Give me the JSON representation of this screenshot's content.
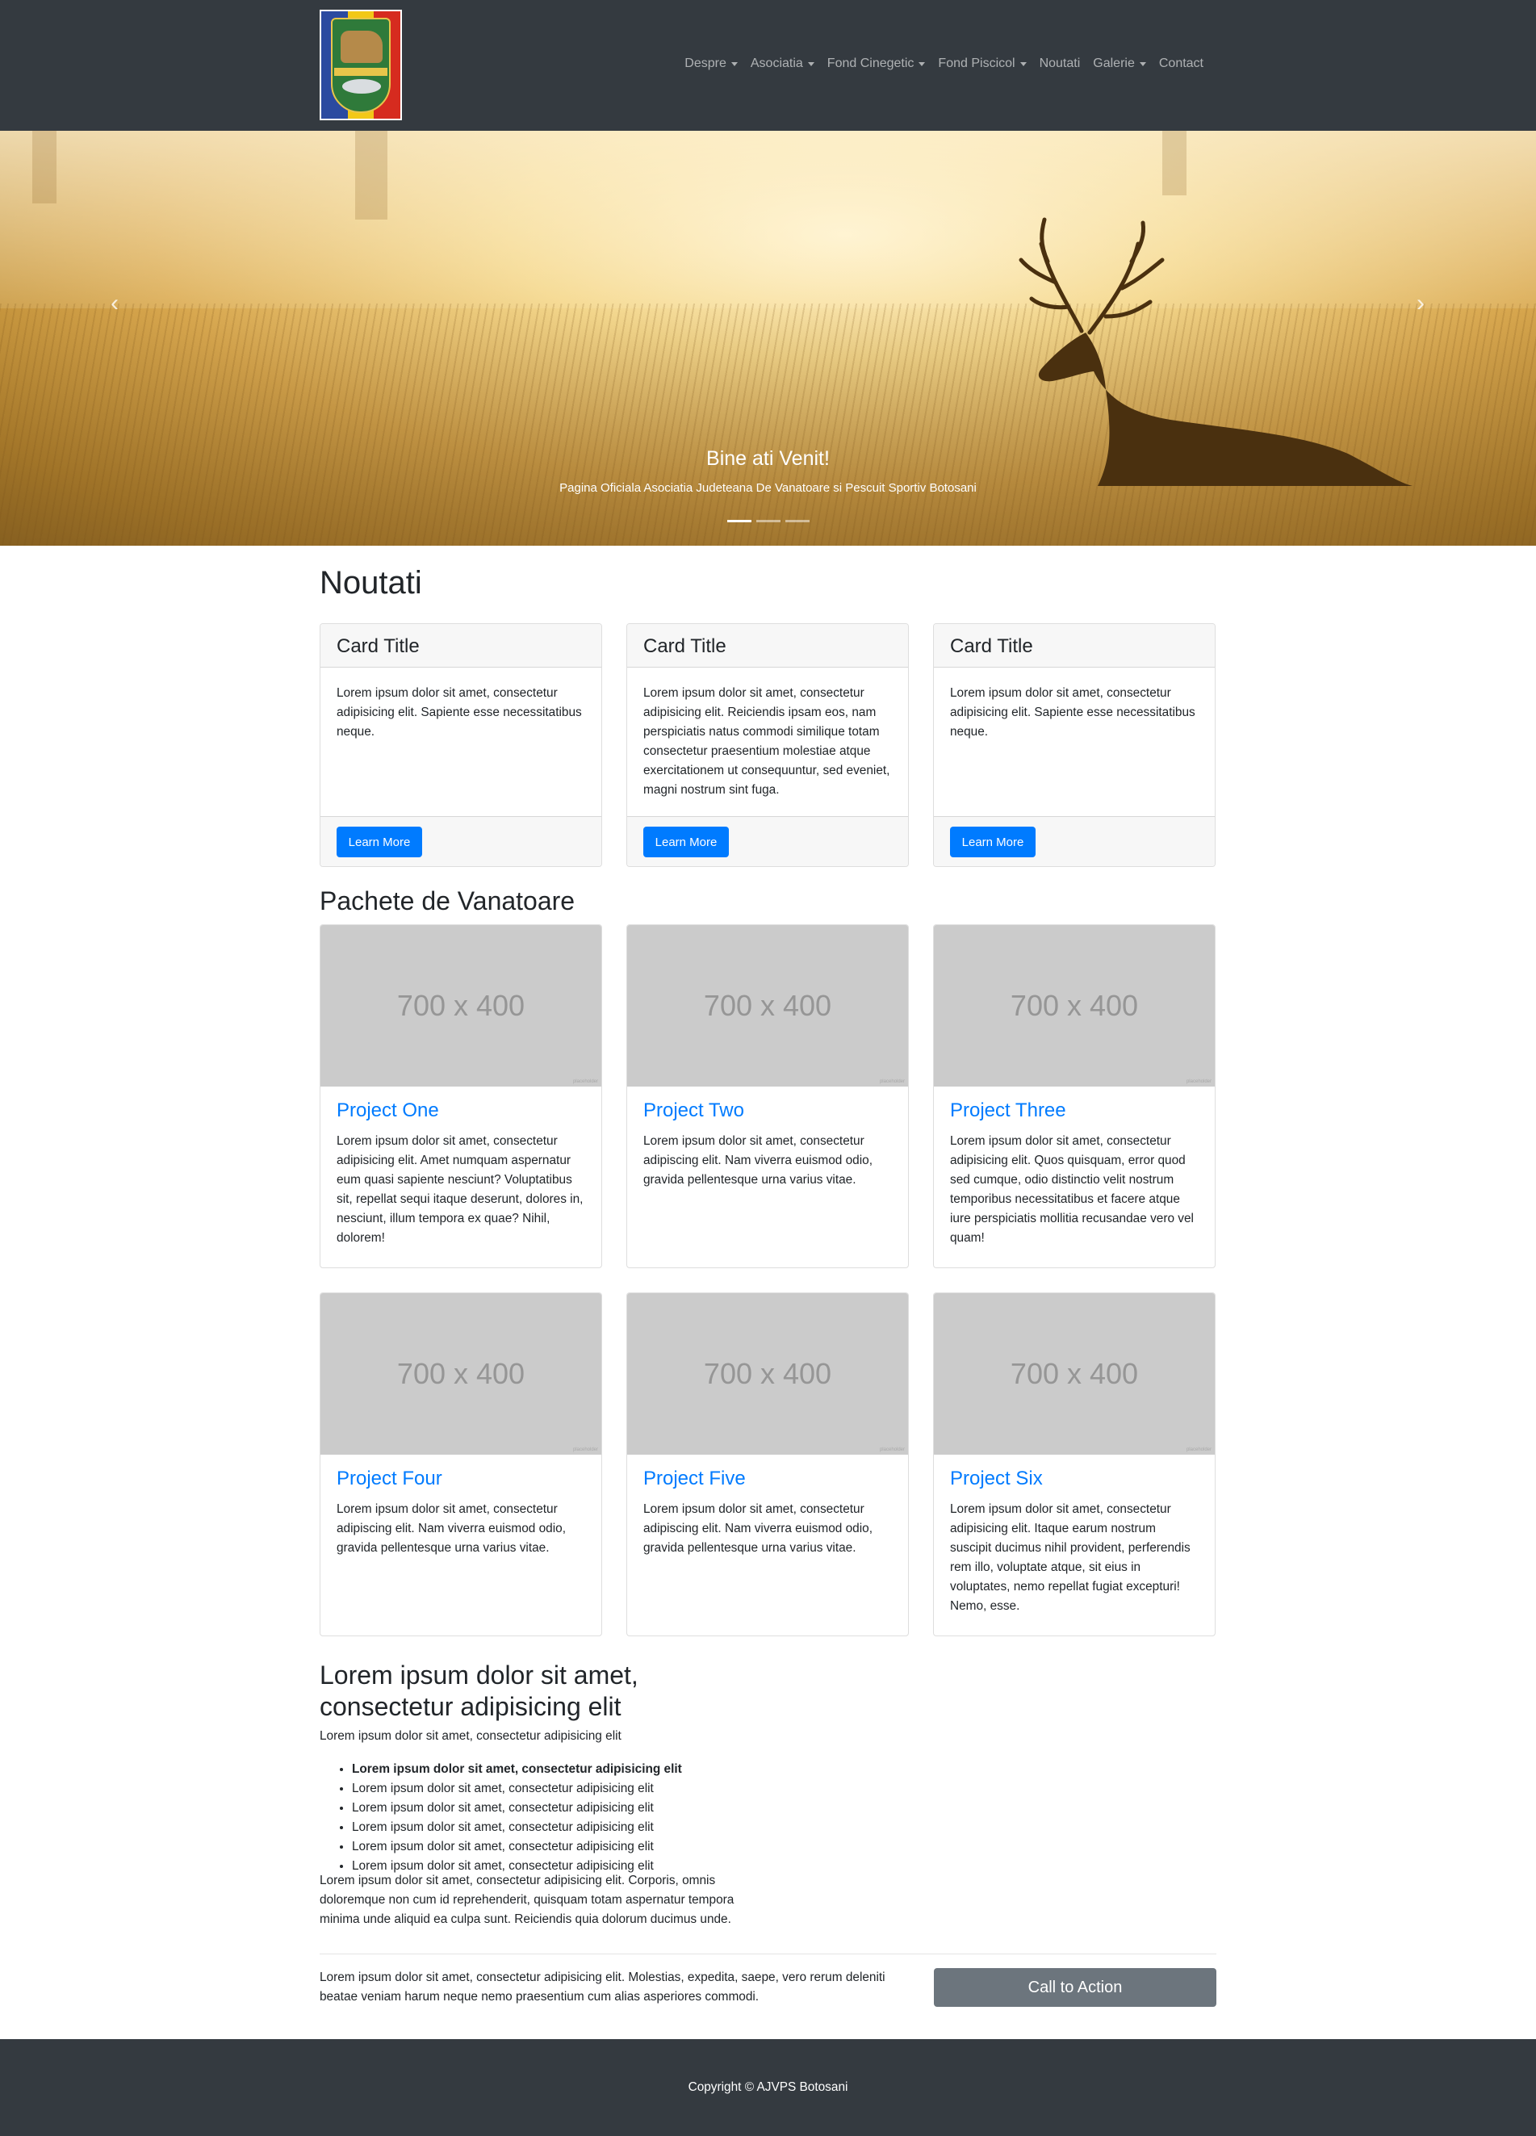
{
  "colors": {
    "navbar_bg": "#343a40",
    "primary": "#007bff",
    "secondary": "#6c757d",
    "placeholder": "#cbcbcb"
  },
  "logo": {
    "icon": "ajvps-coat-of-arms-logo",
    "emblem_text": "AJVPS BOTOSANI"
  },
  "nav": [
    {
      "label": "Despre",
      "dropdown": true
    },
    {
      "label": "Asociatia",
      "dropdown": true
    },
    {
      "label": "Fond Cinegetic",
      "dropdown": true
    },
    {
      "label": "Fond Piscicol",
      "dropdown": true
    },
    {
      "label": "Noutati",
      "dropdown": false
    },
    {
      "label": "Galerie",
      "dropdown": true
    },
    {
      "label": "Contact",
      "dropdown": false
    }
  ],
  "hero": {
    "title": "Bine ati Venit!",
    "subtitle": "Pagina Oficiala Asociatia Judeteana De Vanatoare si Pescuit Sportiv Botosani",
    "prev_icon": "chevron-left-icon",
    "next_icon": "chevron-right-icon",
    "slides": 3,
    "active_slide": 1
  },
  "news": {
    "heading": "Noutati",
    "cards": [
      {
        "title": "Card Title",
        "text": "Lorem ipsum dolor sit amet, consectetur adipisicing elit. Sapiente esse necessitatibus neque.",
        "button": "Learn More"
      },
      {
        "title": "Card Title",
        "text": "Lorem ipsum dolor sit amet, consectetur adipisicing elit. Reiciendis ipsam eos, nam perspiciatis natus commodi similique totam consectetur praesentium molestiae atque exercitationem ut consequuntur, sed eveniet, magni nostrum sint fuga.",
        "button": "Learn More"
      },
      {
        "title": "Card Title",
        "text": "Lorem ipsum dolor sit amet, consectetur adipisicing elit. Sapiente esse necessitatibus neque.",
        "button": "Learn More"
      }
    ]
  },
  "packages": {
    "heading": "Pachete de Vanatoare",
    "placeholder": "700 x 400",
    "items": [
      {
        "title": "Project One",
        "text": "Lorem ipsum dolor sit amet, consectetur adipisicing elit. Amet numquam aspernatur eum quasi sapiente nesciunt? Voluptatibus sit, repellat sequi itaque deserunt, dolores in, nesciunt, illum tempora ex quae? Nihil, dolorem!"
      },
      {
        "title": "Project Two",
        "text": "Lorem ipsum dolor sit amet, consectetur adipiscing elit. Nam viverra euismod odio, gravida pellentesque urna varius vitae."
      },
      {
        "title": "Project Three",
        "text": "Lorem ipsum dolor sit amet, consectetur adipisicing elit. Quos quisquam, error quod sed cumque, odio distinctio velit nostrum temporibus necessitatibus et facere atque iure perspiciatis mollitia recusandae vero vel quam!"
      },
      {
        "title": "Project Four",
        "text": "Lorem ipsum dolor sit amet, consectetur adipiscing elit. Nam viverra euismod odio, gravida pellentesque urna varius vitae."
      },
      {
        "title": "Project Five",
        "text": "Lorem ipsum dolor sit amet, consectetur adipiscing elit. Nam viverra euismod odio, gravida pellentesque urna varius vitae."
      },
      {
        "title": "Project Six",
        "text": "Lorem ipsum dolor sit amet, consectetur adipisicing elit. Itaque earum nostrum suscipit ducimus nihil provident, perferendis rem illo, voluptate atque, sit eius in voluptates, nemo repellat fugiat excepturi! Nemo, esse."
      }
    ]
  },
  "about": {
    "heading": "Lorem ipsum dolor sit amet, consectetur adipisicing elit",
    "intro": "Lorem ipsum dolor sit amet, consectetur adipisicing elit",
    "list": [
      "Lorem ipsum dolor sit amet, consectetur adipisicing elit",
      "Lorem ipsum dolor sit amet, consectetur adipisicing elit",
      "Lorem ipsum dolor sit amet, consectetur adipisicing elit",
      "Lorem ipsum dolor sit amet, consectetur adipisicing elit",
      "Lorem ipsum dolor sit amet, consectetur adipisicing elit",
      "Lorem ipsum dolor sit amet, consectetur adipisicing elit"
    ],
    "paragraph": "Lorem ipsum dolor sit amet, consectetur adipisicing elit. Corporis, omnis doloremque non cum id reprehenderit, quisquam totam aspernatur tempora minima unde aliquid ea culpa sunt. Reiciendis quia dolorum ducimus unde."
  },
  "cta": {
    "text": "Lorem ipsum dolor sit amet, consectetur adipisicing elit. Molestias, expedita, saepe, vero rerum deleniti beatae veniam harum neque nemo praesentium cum alias asperiores commodi.",
    "button": "Call to Action"
  },
  "footer": {
    "copyright": "Copyright © AJVPS Botosani"
  }
}
